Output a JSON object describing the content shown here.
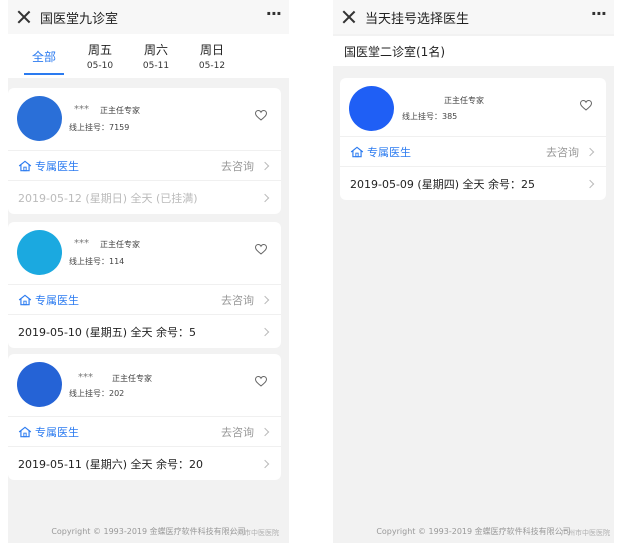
{
  "left": {
    "header": {
      "title": "国医堂九诊室",
      "more": "···"
    },
    "tabs": [
      {
        "day": "全部",
        "date": ""
      },
      {
        "day": "周五",
        "date": "05-10"
      },
      {
        "day": "周六",
        "date": "05-11"
      },
      {
        "day": "周日",
        "date": "05-12"
      }
    ],
    "doctors": [
      {
        "name": "***",
        "title": "正主任专家",
        "reg": "线上挂号：7159",
        "avatar_color": "#2a6fd8",
        "link_label": "专属医生",
        "link_action": "去咨询",
        "slot": "2019-05-12 (星期日)  全天 (已挂满)",
        "slot_full": true
      },
      {
        "name": "***",
        "title": "正主任专家",
        "reg": "线上挂号：114",
        "avatar_color": "#1ba9e0",
        "link_label": "专属医生",
        "link_action": "去咨询",
        "slot": "2019-05-10 (星期五)  全天  余号：5",
        "slot_full": false
      },
      {
        "name": "***",
        "title": "正主任专家",
        "reg": "线上挂号：202",
        "avatar_color": "#2563d6",
        "link_label": "专属医生",
        "link_action": "去咨询",
        "slot": "2019-05-11 (星期六)  全天  余号：20",
        "slot_full": false
      }
    ],
    "copyright": "Copyright © 1993-2019 金蝶医疗软件科技有限公司",
    "watermark": "广州市中医医院"
  },
  "right": {
    "header": {
      "title": "当天挂号选择医生",
      "more": "···"
    },
    "dept": "国医堂二诊室(1名)",
    "doctors": [
      {
        "name": "",
        "title": "正主任专家",
        "reg": "线上挂号：385",
        "avatar_color": "#1f5ff5",
        "link_label": "专属医生",
        "link_action": "去咨询",
        "slot": "2019-05-09 (星期四)  全天  余号：25",
        "slot_full": false
      }
    ],
    "copyright": "Copyright © 1993-2019 金蝶医疗软件科技有限公司",
    "watermark": "广州市中医医院"
  },
  "colors": {
    "accent": "#2b7bf0",
    "background": "#f2f2f2",
    "card": "#ffffff"
  }
}
